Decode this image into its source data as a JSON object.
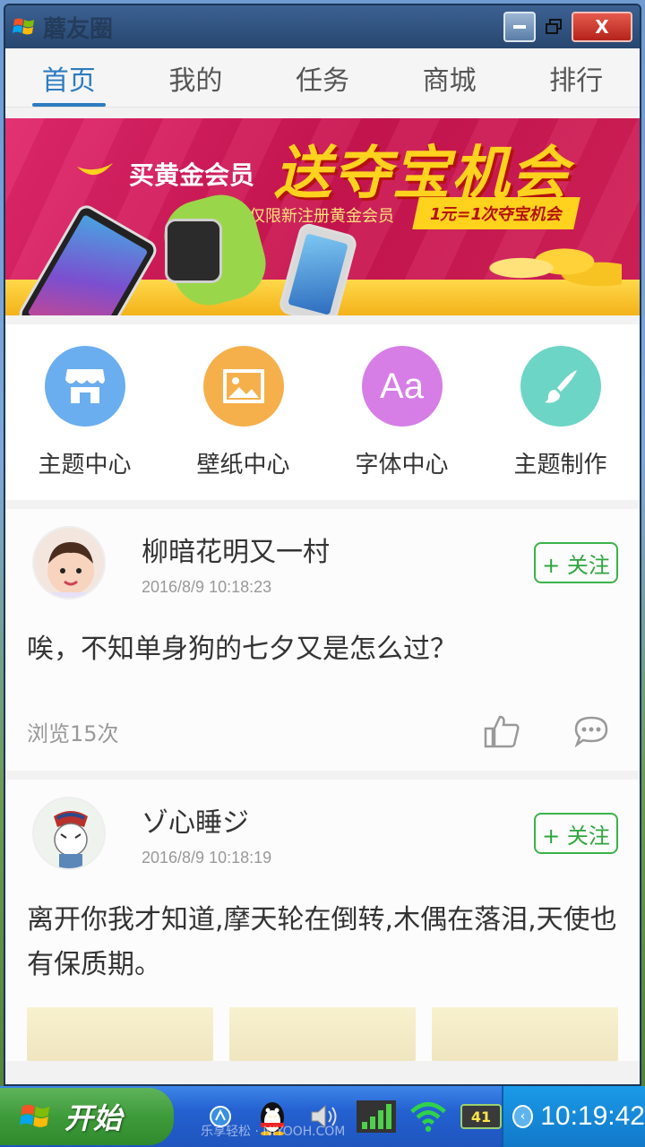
{
  "window": {
    "title": "蘑友圈",
    "close_label": "X"
  },
  "tabs": [
    {
      "label": "首页",
      "active": true
    },
    {
      "label": "我的",
      "active": false
    },
    {
      "label": "任务",
      "active": false
    },
    {
      "label": "商城",
      "active": false
    },
    {
      "label": "排行",
      "active": false
    }
  ],
  "banner": {
    "subtitle": "买黄金会员",
    "headline": "送夺宝机会",
    "note": "仅限新注册黄金会员",
    "pill": "1元=1次夺宝机会"
  },
  "categories": [
    {
      "label": "主题中心",
      "icon": "store-icon",
      "color": "#6aaef0"
    },
    {
      "label": "壁纸中心",
      "icon": "image-icon",
      "color": "#f5b04c"
    },
    {
      "label": "字体中心",
      "icon": "font-icon",
      "icon_text": "Aa",
      "color": "#d67ee6"
    },
    {
      "label": "主题制作",
      "icon": "brush-icon",
      "color": "#6dd5c5"
    }
  ],
  "posts": [
    {
      "author": "柳暗花明又一村",
      "time": "2016/8/9 10:18:23",
      "follow_label": "+ 关注",
      "text": "唉，不知单身狗的七夕又是怎么过？",
      "views": "浏览15次"
    },
    {
      "author": "ゾ心睡ジ",
      "time": "2016/8/9 10:18:19",
      "follow_label": "+ 关注",
      "text": "离开你我才知道,摩天轮在倒转,木偶在落泪,天使也有保质期。"
    }
  ],
  "taskbar": {
    "start_label": "开始",
    "watermark": "乐享轻松 · NIYOOH.COM",
    "battery": "41",
    "clock": "10:19:42"
  },
  "colors": {
    "accent": "#2c7cc0",
    "follow_green": "#3bb24a",
    "taskbar_blue": "#2461d1"
  }
}
